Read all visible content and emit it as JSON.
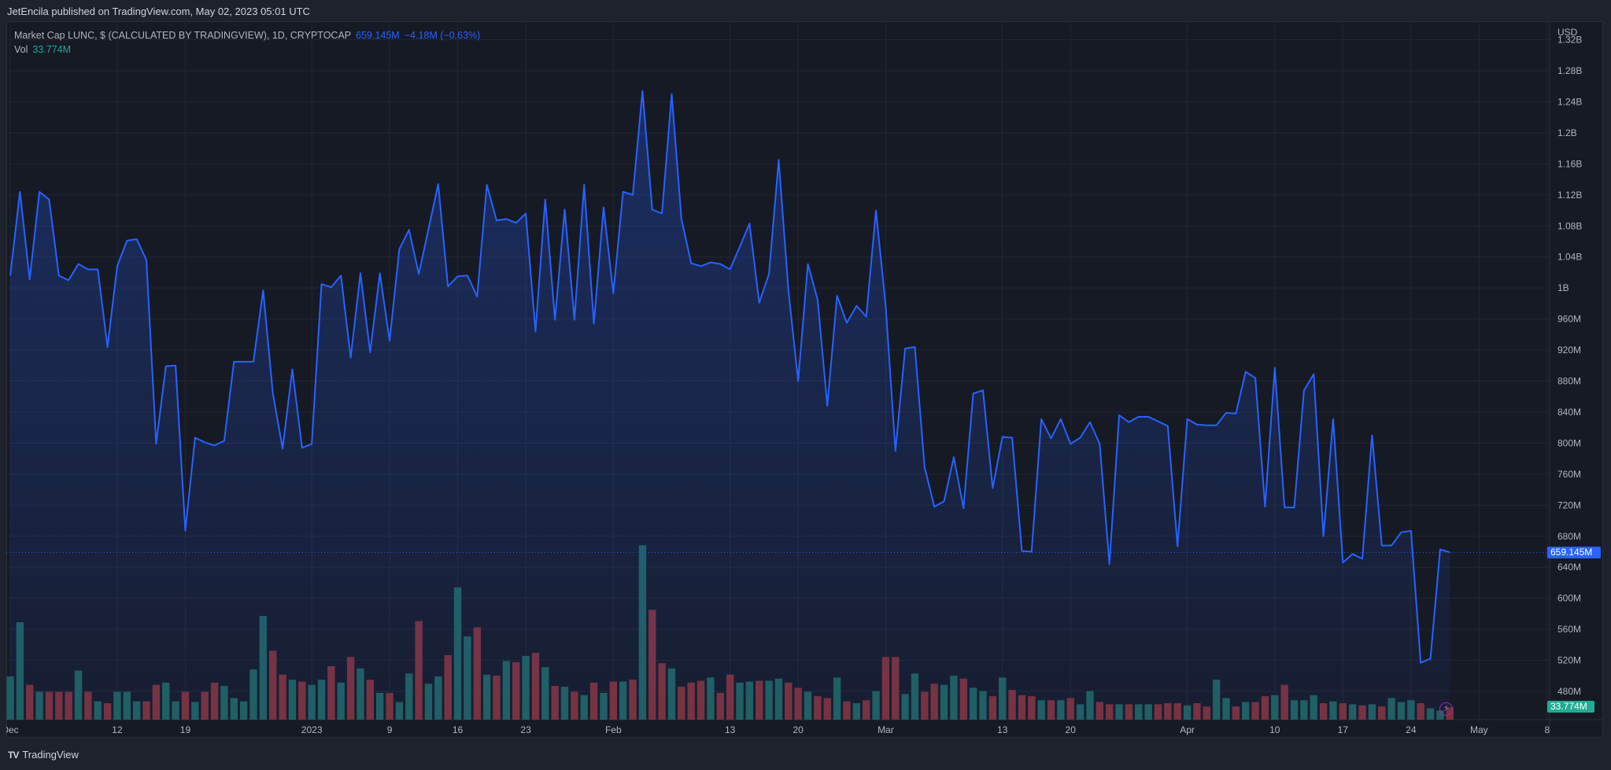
{
  "header": {
    "published": "JetEncila published on TradingView.com, May 02, 2023 05:01 UTC"
  },
  "legend": {
    "symbol": "Market Cap LUNC, $ (CALCULATED BY TRADINGVIEW), 1D, CRYPTOCAP",
    "last": "659.145M",
    "change": "−4.18M (−0.63%)",
    "vol_label": "Vol",
    "vol_value": "33.774M"
  },
  "axis": {
    "currency": "USD",
    "last_price_label": "659.145M",
    "last_vol_label": "33.774M"
  },
  "footer": {
    "brand": "TradingView"
  },
  "colors": {
    "line": "#2962ff",
    "up": "#26a69a",
    "down": "#ef5350",
    "bg": "#161a25"
  },
  "chart_data": {
    "type": "line",
    "title": "Market Cap LUNC, $",
    "ylabel": "USD",
    "start_date": "2022-12-01",
    "y_unit": "M",
    "ylim": [
      440,
      1320
    ],
    "y_ticks": [
      {
        "v": 1320,
        "label": "1.32B"
      },
      {
        "v": 1280,
        "label": "1.28B"
      },
      {
        "v": 1240,
        "label": "1.24B"
      },
      {
        "v": 1200,
        "label": "1.2B"
      },
      {
        "v": 1160,
        "label": "1.16B"
      },
      {
        "v": 1120,
        "label": "1.12B"
      },
      {
        "v": 1080,
        "label": "1.08B"
      },
      {
        "v": 1040,
        "label": "1.04B"
      },
      {
        "v": 1000,
        "label": "1B"
      },
      {
        "v": 960,
        "label": "960M"
      },
      {
        "v": 920,
        "label": "920M"
      },
      {
        "v": 880,
        "label": "880M"
      },
      {
        "v": 840,
        "label": "840M"
      },
      {
        "v": 800,
        "label": "800M"
      },
      {
        "v": 760,
        "label": "760M"
      },
      {
        "v": 720,
        "label": "720M"
      },
      {
        "v": 680,
        "label": "680M"
      },
      {
        "v": 640,
        "label": "640M"
      },
      {
        "v": 600,
        "label": "600M"
      },
      {
        "v": 560,
        "label": "560M"
      },
      {
        "v": 520,
        "label": "520M"
      },
      {
        "v": 480,
        "label": "480M"
      }
    ],
    "x_ticks": [
      {
        "day": 0,
        "label": "Dec"
      },
      {
        "day": 11,
        "label": "12"
      },
      {
        "day": 18,
        "label": "19"
      },
      {
        "day": 31,
        "label": "2023"
      },
      {
        "day": 39,
        "label": "9"
      },
      {
        "day": 46,
        "label": "16"
      },
      {
        "day": 53,
        "label": "23"
      },
      {
        "day": 62,
        "label": "Feb"
      },
      {
        "day": 74,
        "label": "13"
      },
      {
        "day": 81,
        "label": "20"
      },
      {
        "day": 90,
        "label": "Mar"
      },
      {
        "day": 102,
        "label": "13"
      },
      {
        "day": 109,
        "label": "20"
      },
      {
        "day": 121,
        "label": "Apr"
      },
      {
        "day": 130,
        "label": "10"
      },
      {
        "day": 137,
        "label": "17"
      },
      {
        "day": 144,
        "label": "24"
      },
      {
        "day": 151,
        "label": "May"
      },
      {
        "day": 158,
        "label": "8"
      }
    ],
    "market_cap": [
      1016,
      1124,
      1011,
      1124,
      1114,
      1016,
      1010,
      1031,
      1024,
      1024,
      924,
      1028,
      1061,
      1063,
      1036,
      799,
      899,
      900,
      687,
      807,
      801,
      797,
      803,
      905,
      905,
      905,
      997,
      864,
      793,
      895,
      794,
      799,
      1005,
      1001,
      1016,
      910,
      1019,
      917,
      1019,
      932,
      1050,
      1075,
      1018,
      1076,
      1134,
      1002,
      1015,
      1016,
      989,
      1133,
      1087,
      1089,
      1084,
      1096,
      944,
      1114,
      959,
      1101,
      959,
      1133,
      954,
      1104,
      993,
      1124,
      1120,
      1254,
      1101,
      1096,
      1250,
      1089,
      1032,
      1028,
      1033,
      1031,
      1024,
      1053,
      1083,
      981,
      1018,
      1165,
      997,
      880,
      1031,
      985,
      848,
      990,
      955,
      977,
      963,
      1100,
      977,
      790,
      922,
      924,
      769,
      718,
      725,
      782,
      716,
      864,
      868,
      742,
      808,
      807,
      661,
      660,
      831,
      806,
      831,
      799,
      807,
      827,
      799,
      644,
      836,
      827,
      834,
      834,
      828,
      822,
      667,
      831,
      824,
      823,
      823,
      839,
      838,
      892,
      884,
      718,
      897,
      717,
      717,
      868,
      889,
      680,
      831,
      646,
      657,
      651,
      810,
      668,
      668,
      685,
      687,
      517,
      522,
      663,
      659.145
    ],
    "volume": [
      118,
      266,
      95,
      76,
      76,
      76,
      76,
      134,
      76,
      50,
      45,
      76,
      76,
      50,
      50,
      95,
      101,
      50,
      76,
      48,
      76,
      101,
      92,
      59,
      50,
      137,
      283,
      188,
      123,
      109,
      104,
      95,
      109,
      146,
      101,
      171,
      140,
      109,
      73,
      73,
      48,
      126,
      269,
      98,
      118,
      176,
      361,
      227,
      252,
      123,
      120,
      160,
      157,
      174,
      182,
      143,
      92,
      90,
      76,
      67,
      101,
      73,
      104,
      104,
      109,
      476,
      300,
      154,
      140,
      90,
      101,
      106,
      115,
      73,
      123,
      101,
      104,
      106,
      106,
      112,
      101,
      87,
      76,
      64,
      59,
      115,
      50,
      45,
      53,
      78,
      171,
      171,
      70,
      126,
      76,
      98,
      95,
      120,
      112,
      87,
      78,
      64,
      115,
      81,
      67,
      64,
      53,
      53,
      53,
      59,
      42,
      78,
      48,
      42,
      42,
      42,
      42,
      42,
      42,
      45,
      45,
      39,
      45,
      36,
      109,
      59,
      36,
      48,
      48,
      64,
      67,
      95,
      53,
      53,
      67,
      45,
      50,
      45,
      42,
      39,
      42,
      36,
      59,
      48,
      53,
      45,
      31,
      25,
      33.774
    ]
  }
}
